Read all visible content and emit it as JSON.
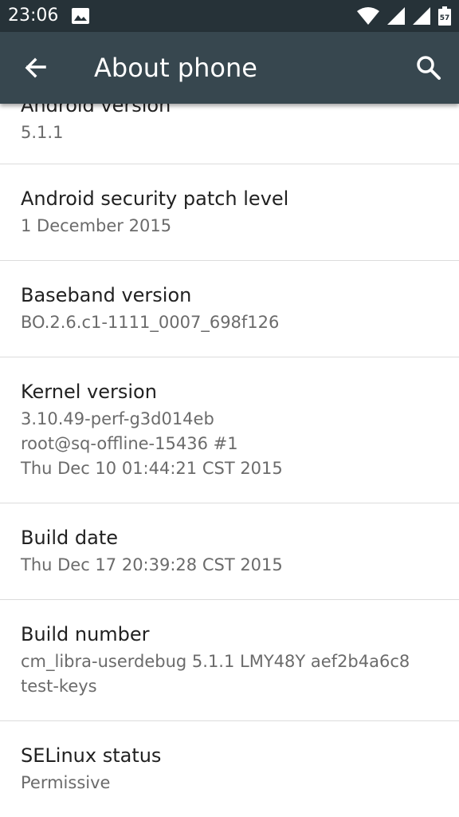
{
  "status_bar": {
    "time": "23:06",
    "battery_level": "57",
    "icons": [
      "image-icon",
      "wifi-icon",
      "signal-icon",
      "signal-icon",
      "battery-icon"
    ]
  },
  "app_bar": {
    "title": "About phone",
    "back_icon": "arrow-back-icon",
    "search_icon": "search-icon"
  },
  "items": [
    {
      "title": "Android version",
      "summary": "5.1.1"
    },
    {
      "title": "Android security patch level",
      "summary": "1 December 2015"
    },
    {
      "title": "Baseband version",
      "summary": "BO.2.6.c1-1111_0007_698f126"
    },
    {
      "title": "Kernel version",
      "summary": "3.10.49-perf-g3d014eb\nroot@sq-offline-15436 #1\nThu Dec 10 01:44:21 CST 2015"
    },
    {
      "title": "Build date",
      "summary": "Thu Dec 17 20:39:28 CST 2015"
    },
    {
      "title": "Build number",
      "summary": "cm_libra-userdebug 5.1.1 LMY48Y aef2b4a6c8\ntest-keys"
    },
    {
      "title": "SELinux status",
      "summary": "Permissive"
    }
  ],
  "colors": {
    "status_bar": "#263238",
    "app_bar": "#37474f",
    "title_text": "#212121",
    "summary_text": "#6b6b6b",
    "divider": "#dcdcdc"
  }
}
